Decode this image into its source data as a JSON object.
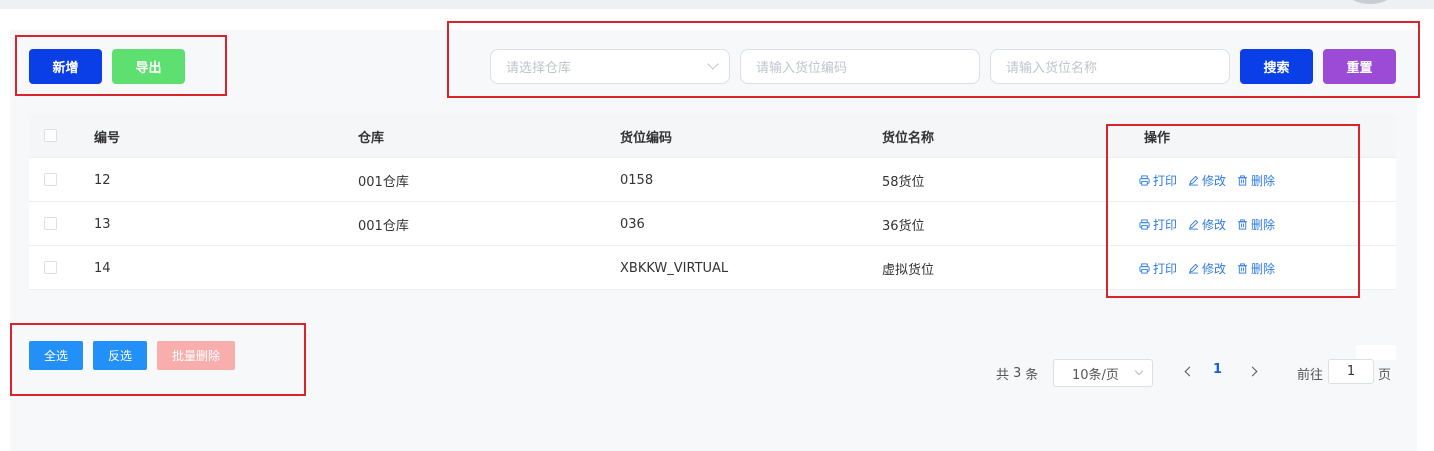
{
  "toolbar": {
    "add_label": "新增",
    "export_label": "导出",
    "warehouse_placeholder": "请选择仓库",
    "location_code_placeholder": "请输入货位编码",
    "location_name_placeholder": "请输入货位名称",
    "search_label": "搜索",
    "reset_label": "重置"
  },
  "table": {
    "headers": [
      "编号",
      "仓库",
      "货位编码",
      "货位名称",
      "操作"
    ],
    "rows": [
      {
        "id": "12",
        "warehouse": "001仓库",
        "code": "0158",
        "name": "58货位"
      },
      {
        "id": "13",
        "warehouse": "001仓库",
        "code": "036",
        "name": "36货位"
      },
      {
        "id": "14",
        "warehouse": "",
        "code": "XBKKW_VIRTUAL",
        "name": "虚拟货位"
      }
    ],
    "actions": {
      "print": "打印",
      "edit": "修改",
      "delete": "删除"
    }
  },
  "bulk": {
    "select_all": "全选",
    "invert": "反选",
    "batch_delete": "批量删除"
  },
  "pagination": {
    "total_prefix": "共",
    "total": "3",
    "total_suffix": "条",
    "page_size": "10条/页",
    "current_page": "1",
    "goto_prefix": "前往",
    "goto_value": "1",
    "goto_suffix": "页"
  },
  "colors": {
    "primary": "#0a3ee6",
    "success": "#5ee070",
    "purple": "#9b4bd6",
    "link": "#2e7be6",
    "highlight_box": "#d9232d"
  }
}
